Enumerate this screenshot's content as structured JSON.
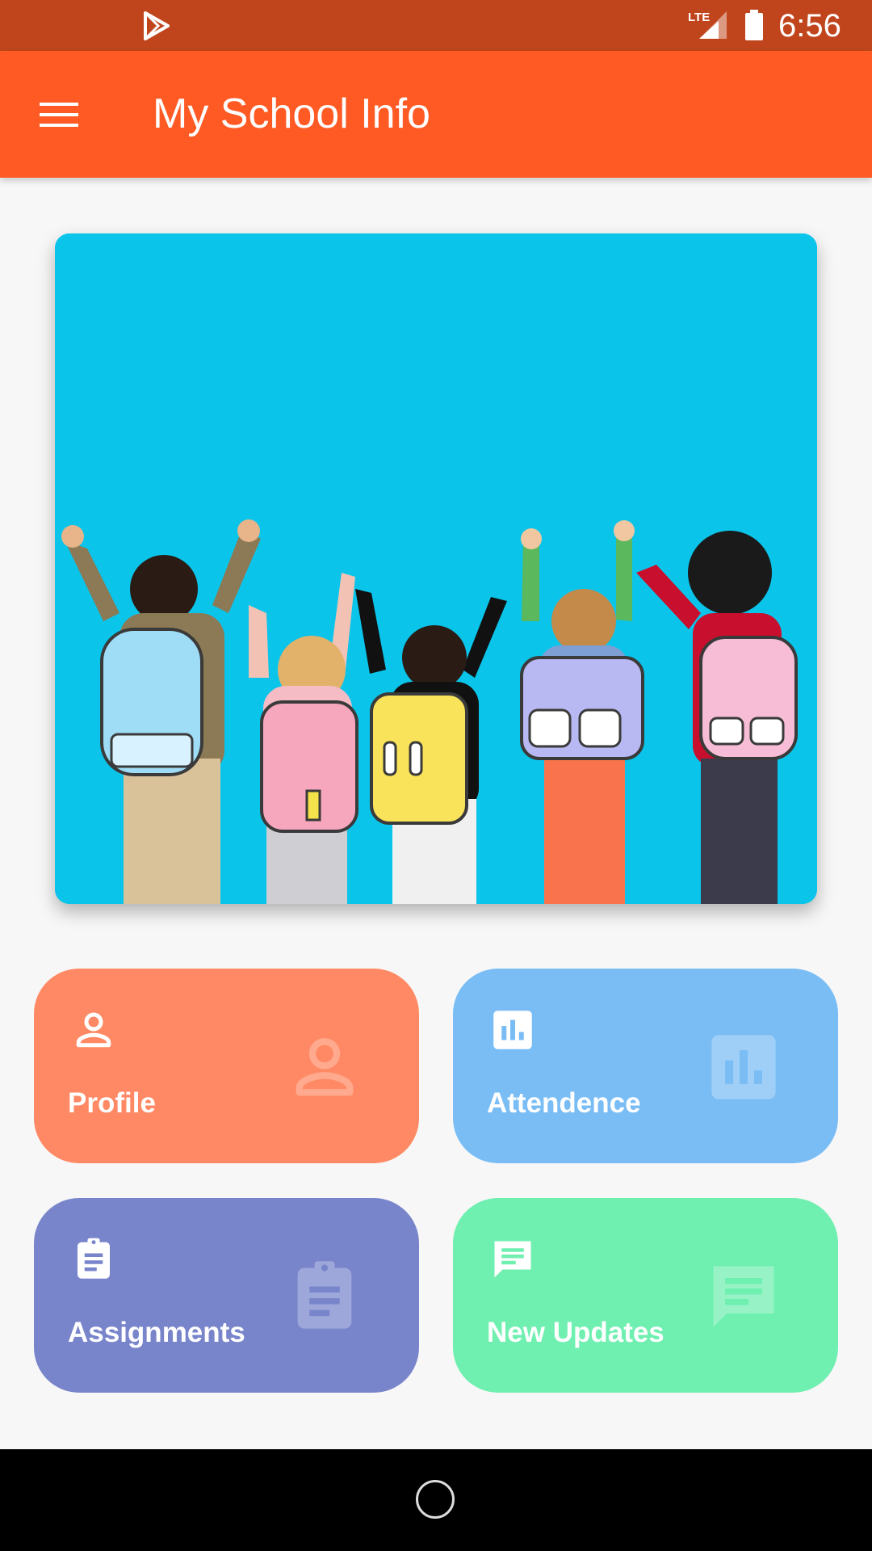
{
  "status_bar": {
    "time": "6:56",
    "network_label": "LTE",
    "icons": [
      "play-store-icon",
      "lte-signal-icon",
      "battery-icon"
    ]
  },
  "app_bar": {
    "title": "My School Info",
    "menu_icon": "menu-icon"
  },
  "hero": {
    "image": "children-with-backpacks-photo",
    "background_color": "#0bc4ea"
  },
  "tiles": [
    {
      "label": "Profile",
      "icon": "person-icon",
      "color": "#ff8964"
    },
    {
      "label": "Attendence",
      "icon": "bar-chart-icon",
      "color": "#7abdf5"
    },
    {
      "label": "Assignments",
      "icon": "clipboard-icon",
      "color": "#7985cb"
    },
    {
      "label": "New Updates",
      "icon": "message-icon",
      "color": "#6fefb0"
    }
  ],
  "colors": {
    "status_bar": "#c0451d",
    "app_bar": "#ff5a24",
    "background": "#f7f7f7",
    "nav_bar": "#000000"
  }
}
